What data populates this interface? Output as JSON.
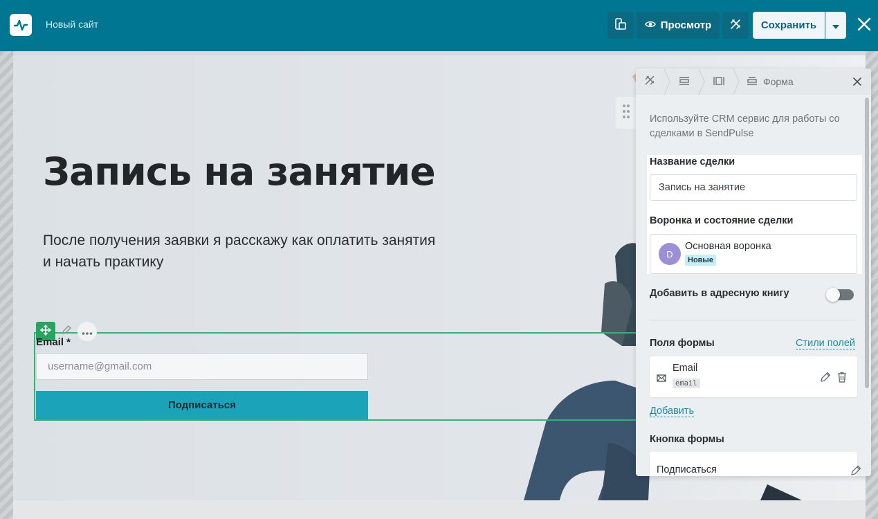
{
  "topbar": {
    "site_name": "Новый сайт",
    "preview_label": "Просмотр",
    "save_label": "Сохранить"
  },
  "hero": {
    "title": "Запись на занятие",
    "subtitle": "После получения заявки я расскажу как оплатить занятия и начать практику"
  },
  "form": {
    "email_label": "Email *",
    "email_placeholder": "username@gmail.com",
    "submit_label": "Подписаться"
  },
  "panel": {
    "breadcrumb_label": "Форма",
    "description": "Используйте CRM сервис для работы со сделками в SendPulse",
    "deal_name_label": "Название сделки",
    "deal_name_value": "Запись на занятие",
    "funnel_label": "Воронка и состояние сделки",
    "funnel_avatar": "D",
    "funnel_name": "Основная воронка",
    "funnel_status": "Новые",
    "address_book_label": "Добавить в адресную книгу",
    "address_book_enabled": false,
    "form_fields_label": "Поля формы",
    "field_styles_link": "Стили полей",
    "field_name": "Email",
    "field_tag": "email",
    "add_link": "Добавить",
    "form_button_label": "Кнопка формы",
    "button_text": "Подписаться"
  },
  "colors": {
    "topbar": "#007692",
    "accent_green": "#26a561",
    "submit_button": "#1ba3ba",
    "link": "#1b8aa6",
    "avatar": "#9c8fd6",
    "badge": "#c6eef8"
  },
  "icons": [
    "pulse-logo-icon",
    "mobile-desktop-icon",
    "eye-icon",
    "design-tools-icon",
    "caret-down-icon",
    "close-icon",
    "move-icon",
    "pencil-icon",
    "more-icon",
    "drag-handle-icon",
    "rows-icon",
    "columns-icon",
    "form-icon",
    "mail-icon",
    "trash-icon"
  ]
}
